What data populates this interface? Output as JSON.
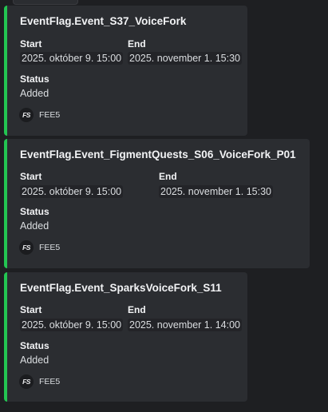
{
  "cards": [
    {
      "title": "EventFlag.Event_S37_VoiceFork",
      "start_label": "Start",
      "start_value": "2025. október 9. 15:00",
      "end_label": "End",
      "end_value": "2025. november 1. 15:30",
      "status_label": "Status",
      "status_value": "Added",
      "footer_icon": "FS",
      "footer_text": "FEE5"
    },
    {
      "title": "EventFlag.Event_FigmentQuests_S06_VoiceFork_P01",
      "start_label": "Start",
      "start_value": "2025. október 9. 15:00",
      "end_label": "End",
      "end_value": "2025. november 1. 15:30",
      "status_label": "Status",
      "status_value": "Added",
      "footer_icon": "FS",
      "footer_text": "FEE5"
    },
    {
      "title": "EventFlag.Event_SparksVoiceFork_S11",
      "start_label": "Start",
      "start_value": "2025. október 9. 15:00",
      "end_label": "End",
      "end_value": "2025. november 1. 14:00",
      "status_label": "Status",
      "status_value": "Added",
      "footer_icon": "FS",
      "footer_text": "FEE5"
    }
  ],
  "colors": {
    "accent": "#23c552",
    "card_bg": "#2b2d31",
    "page_bg": "#1e1f22"
  }
}
